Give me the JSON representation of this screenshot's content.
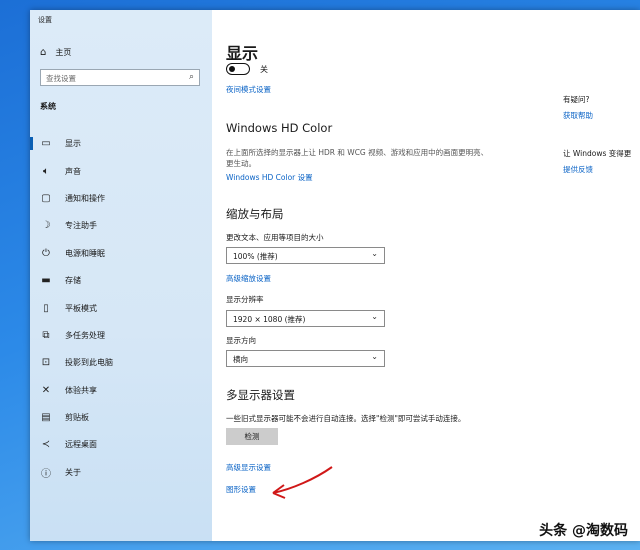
{
  "window": {
    "title": "设置"
  },
  "sidebar": {
    "home_label": "主页",
    "search_placeholder": "查找设置",
    "section_label": "系统",
    "items": [
      {
        "label": "显示",
        "icon": "monitor-icon"
      },
      {
        "label": "声音",
        "icon": "speaker-icon"
      },
      {
        "label": "通知和操作",
        "icon": "notification-icon"
      },
      {
        "label": "专注助手",
        "icon": "moon-icon"
      },
      {
        "label": "电源和睡眠",
        "icon": "power-icon"
      },
      {
        "label": "存储",
        "icon": "storage-icon"
      },
      {
        "label": "平板模式",
        "icon": "tablet-icon"
      },
      {
        "label": "多任务处理",
        "icon": "multitask-icon"
      },
      {
        "label": "投影到此电脑",
        "icon": "project-icon"
      },
      {
        "label": "体验共享",
        "icon": "share-icon"
      },
      {
        "label": "剪贴板",
        "icon": "clipboard-icon"
      },
      {
        "label": "远程桌面",
        "icon": "remote-icon"
      },
      {
        "label": "关于",
        "icon": "info-icon"
      }
    ],
    "selected_index": 0
  },
  "main": {
    "title": "显示",
    "night_light_state": "关",
    "night_light_link": "夜间模式设置",
    "hdr": {
      "heading": "Windows HD Color",
      "description": "在上面所选择的显示器上让 HDR 和 WCG 视频、游戏和应用中的画面更明亮、更生动。",
      "link": "Windows HD Color 设置"
    },
    "scale": {
      "heading": "缩放与布局",
      "text_size_label": "更改文本、应用等项目的大小",
      "text_size_value": "100% (推荐)",
      "advanced_scaling_link": "高级缩放设置",
      "resolution_label": "显示分辨率",
      "resolution_value": "1920 × 1080 (推荐)",
      "orientation_label": "显示方向",
      "orientation_value": "横向"
    },
    "multi": {
      "heading": "多显示器设置",
      "description": "一些旧式显示器可能不会进行自动连接。选择\"检测\"即可尝试手动连接。",
      "detect_button": "检测",
      "advanced_display_link": "高级显示设置",
      "graphics_link": "图形设置"
    }
  },
  "help": {
    "question": "有疑问?",
    "get_help_link": "获取帮助",
    "improve_text": "让 Windows 变得更",
    "feedback_link": "提供反馈"
  },
  "annotation": {
    "arrow_color": "#d01818"
  },
  "watermark": "头条 @淘数码"
}
